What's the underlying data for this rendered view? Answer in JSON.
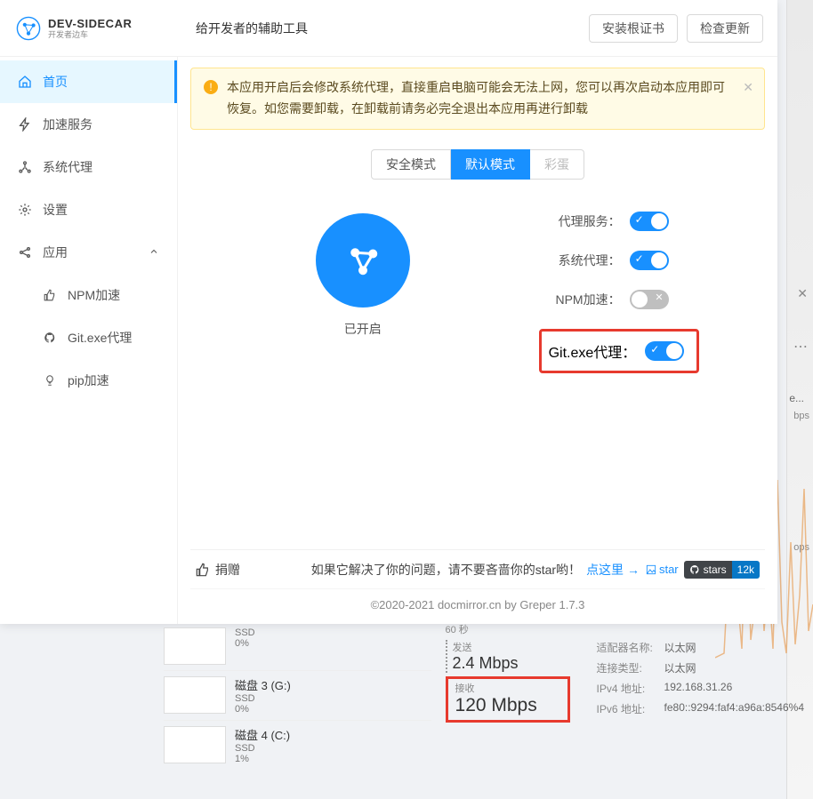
{
  "logo": {
    "name": "DEV-SIDECAR",
    "sub": "开发者边车"
  },
  "header": {
    "title": "给开发者的辅助工具",
    "btn_install_cert": "安装根证书",
    "btn_check_update": "检查更新"
  },
  "sidebar": {
    "items": [
      {
        "label": "首页",
        "icon": "home-icon"
      },
      {
        "label": "加速服务",
        "icon": "bolt-icon"
      },
      {
        "label": "系统代理",
        "icon": "network-icon"
      },
      {
        "label": "设置",
        "icon": "gear-icon"
      },
      {
        "label": "应用",
        "icon": "share-icon"
      }
    ],
    "sub_items": [
      {
        "label": "NPM加速",
        "icon": "thumb-icon"
      },
      {
        "label": "Git.exe代理",
        "icon": "github-icon"
      },
      {
        "label": "pip加速",
        "icon": "bulb-icon"
      }
    ]
  },
  "alert": {
    "text": "本应用开启后会修改系统代理，直接重启电脑可能会无法上网，您可以再次启动本应用即可恢复。如您需要卸载，在卸载前请务必完全退出本应用再进行卸载"
  },
  "mode_tabs": {
    "safe": "安全模式",
    "default": "默认模式",
    "egg": "彩蛋"
  },
  "power": {
    "status_label": "已开启"
  },
  "switches": {
    "proxy_service": {
      "label": "代理服务：",
      "on": true
    },
    "system_proxy": {
      "label": "系统代理：",
      "on": true
    },
    "npm_accel": {
      "label": "NPM加速：",
      "on": false
    },
    "git_proxy": {
      "label": "Git.exe代理：",
      "on": true
    }
  },
  "bottom": {
    "donate": "捐赠",
    "star_text": "如果它解决了你的问题，请不要吝啬你的star哟！",
    "star_link": "点这里 →",
    "broken_alt": "star",
    "gh_stars_label": "stars",
    "gh_stars_count": "12k"
  },
  "footer": {
    "text": "©2020-2021 docmirror.cn by Greper 1.7.3"
  },
  "background_taskmgr": {
    "disks": [
      {
        "name": "",
        "type": "SSD",
        "pct": "0%"
      },
      {
        "name": "磁盘 3 (G:)",
        "type": "SSD",
        "pct": "0%"
      },
      {
        "name": "磁盘 4 (C:)",
        "type": "SSD",
        "pct": "1%"
      }
    ],
    "net": {
      "timespan": "60 秒",
      "send_label": "发送",
      "send_value": "2.4 Mbps",
      "recv_label": "接收",
      "recv_value": "120 Mbps",
      "adapter_name_k": "适配器名称:",
      "adapter_name_v": "以太网",
      "conn_type_k": "连接类型:",
      "conn_type_v": "以太网",
      "ipv4_k": "IPv4 地址:",
      "ipv4_v": "192.168.31.26",
      "ipv6_k": "IPv6 地址:",
      "ipv6_v": "fe80::9294:faf4:a96a:8546%4"
    }
  },
  "edge": {
    "e_label": "e...",
    "bps": "bps",
    "ops": "ops"
  }
}
